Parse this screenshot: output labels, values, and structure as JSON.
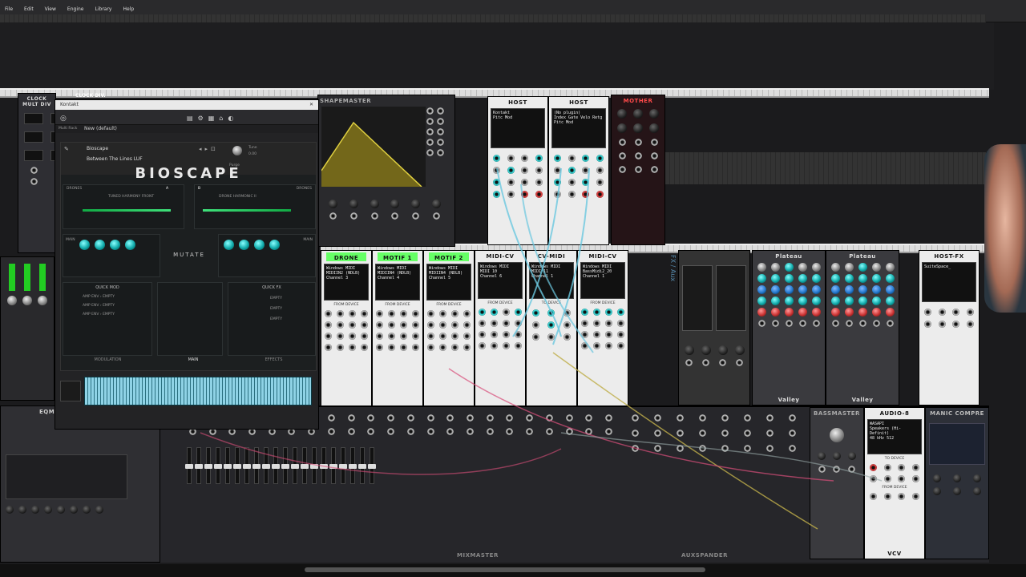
{
  "menu": {
    "items": [
      "File",
      "Edit",
      "View",
      "Engine",
      "Library",
      "Help"
    ]
  },
  "modules": {
    "clock": "CLOCK MULT DIV",
    "clock_div": "CLOCK DIV.",
    "shapemaster": "SHAPEMASTER",
    "host1": {
      "title": "HOST",
      "screen": "Kontakt",
      "line2": "Pitc Mod"
    },
    "host2": {
      "title": "HOST",
      "screen": "(No plugin)",
      "line2": "Index Gate Velo Retg",
      "line3": "Pitc Mod"
    },
    "mother": "MOTHER",
    "midi_modules": [
      {
        "title": "DRONE",
        "screen": "Windows MIDI",
        "screen2": "MIDIIN2 (NDLB)",
        "channel": "Channel 3",
        "label": "FROM DEVICE"
      },
      {
        "title": "MOTIF 1",
        "screen": "Windows MIDI",
        "screen2": "MIDIIN4 (NDLB)",
        "channel": "Channel 4",
        "label": "FROM DEVICE"
      },
      {
        "title": "MOTIF 2",
        "screen": "Windows MIDI",
        "screen2": "MIDIIN4 (NDLB)",
        "channel": "Channel 5",
        "label": "FROM DEVICE"
      },
      {
        "title": "MIDI-CV",
        "screen": "Windows MIDI",
        "screen2": "MIDI 10",
        "channel": "Channel 6",
        "label": "FROM DEVICE"
      },
      {
        "title": "CV-MIDI",
        "screen": "Windows MIDI",
        "screen2": "MIDI 11",
        "channel": "Channel 1",
        "label": "TO DEVICE"
      },
      {
        "title": "MIDI-CV",
        "screen": "Windows MIDI",
        "screen2": "BassMidi2_20",
        "channel": "Channel 1",
        "label": "FROM DEVICE"
      }
    ],
    "fx_aux": "FX / Aux",
    "plateau1": {
      "title": "Plateau",
      "footer": "Valley"
    },
    "plateau2": {
      "title": "Plateau",
      "footer": "Valley"
    },
    "hostfx": {
      "title": "HOST-FX",
      "screen": "SuiteSpace_"
    },
    "audio8": {
      "title": "AUDIO-8",
      "screen": "WASAPI",
      "screen2": "Speakers (Hi-Definit)",
      "screen3": "48 kHz   512",
      "to": "TO DEVICE",
      "from": "FROM DEVICE"
    },
    "bassmaster": "BASSMASTER",
    "manic": "MANIC COMPRE",
    "mixmaster": "MIXMASTER",
    "auxspander": "AUXSPANDER",
    "vcv": "VCV",
    "eqmaster": "EQMASTER"
  },
  "kontakt": {
    "window_title": "Kontakt",
    "preset": "New (default)",
    "rack_label": "Multi Rack",
    "instrument": "Bioscape",
    "snapshot": "Between The Lines LUF",
    "title": "BIOSCAPE",
    "drones_left": "DRONES",
    "drones_right": "DRONES",
    "drone_a": "A",
    "drone_b": "B",
    "layer_left": "TUNED HARMONY FRONT",
    "layer_right": "DRONE HARMONIC II",
    "mutate": "MUTATE",
    "quick_mod": "QUICK MOD",
    "quick_fx": "QUICK FX",
    "amp_env": "AMP ENV",
    "empty": "EMPTY",
    "tabs": [
      "MODULATION",
      "MAIN",
      "EFFECTS"
    ],
    "tune_label": "Tune",
    "tune_value": "0.00",
    "purge": "Purge",
    "main_label": "MAIN"
  }
}
